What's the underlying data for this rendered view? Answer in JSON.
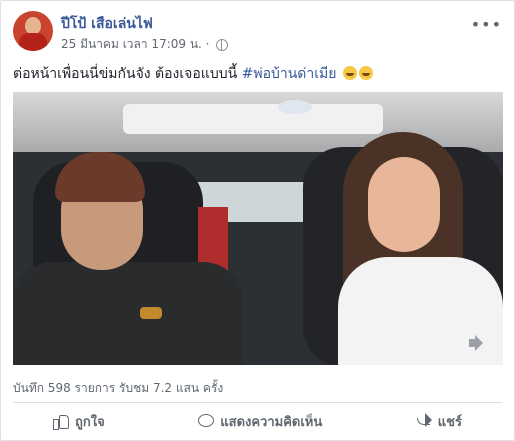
{
  "post": {
    "author": "ปีโป้ เสือเล่นไฟ",
    "timestamp": "25 มีนาคม เวลา 17:09 น. ·",
    "text_prefix": "ต่อหน้าเพื่อนนี่ข่มกันจัง ต้องเจอแบบนี้ ",
    "hashtag": "#พ่อบ้านด่าเมีย",
    "more_label": "•••"
  },
  "stats": {
    "text": "บันทึก 598 รายการ   รับชม 7.2 แสน ครั้ง"
  },
  "actions": {
    "like": "ถูกใจ",
    "comment": "แสดงความคิดเห็น",
    "share": "แชร์"
  },
  "colors": {
    "link": "#385898",
    "hashtag": "#365899",
    "muted": "#606770"
  },
  "icons": [
    "globe-icon",
    "more-icon",
    "laughing-emoji-icon",
    "volume-icon",
    "like-icon",
    "comment-icon",
    "share-icon"
  ]
}
